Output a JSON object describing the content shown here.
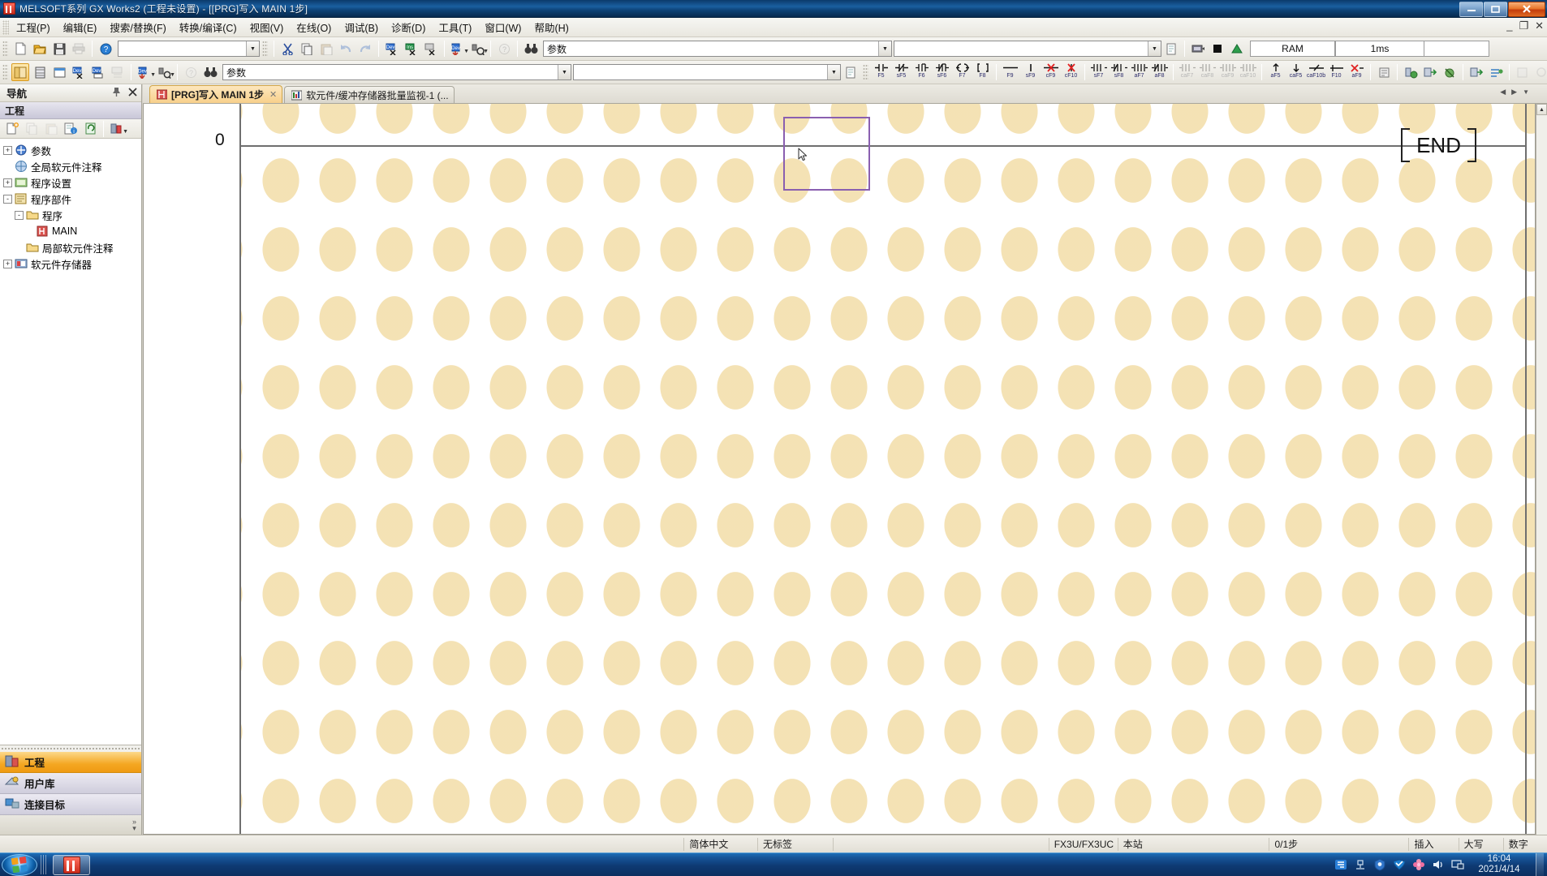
{
  "window": {
    "title": "MELSOFT系列 GX Works2 (工程未设置) - [[PRG]写入 MAIN 1步]",
    "app_icon": "gxworks2-icon",
    "minimize": "—",
    "restore": "❐",
    "close": "✕",
    "mdi_minimize": "_",
    "mdi_restore": "❐",
    "mdi_close": "✕"
  },
  "menubar": {
    "items": [
      {
        "label": "工程(P)",
        "name": "menu-project"
      },
      {
        "label": "编辑(E)",
        "name": "menu-edit"
      },
      {
        "label": "搜索/替换(F)",
        "name": "menu-find-replace"
      },
      {
        "label": "转换/编译(C)",
        "name": "menu-convert-compile"
      },
      {
        "label": "视图(V)",
        "name": "menu-view"
      },
      {
        "label": "在线(O)",
        "name": "menu-online"
      },
      {
        "label": "调试(B)",
        "name": "menu-debug"
      },
      {
        "label": "诊断(D)",
        "name": "menu-diagnostics"
      },
      {
        "label": "工具(T)",
        "name": "menu-tools"
      },
      {
        "label": "窗口(W)",
        "name": "menu-window"
      },
      {
        "label": "帮助(H)",
        "name": "menu-help"
      }
    ]
  },
  "toolbar_status": {
    "memory": "RAM",
    "scan_time": "1ms"
  },
  "toolbar2": {
    "combo_value": "参数",
    "combo_placeholder": "",
    "combo2_value": ""
  },
  "ladder_toolbar": {
    "keys": [
      "F5",
      "sF5",
      "F6",
      "sF6",
      "F7",
      "F8",
      "F9",
      "sF9",
      "cF9",
      "cF10",
      "sF7",
      "sF8",
      "aF7",
      "aF8",
      "caF7",
      "caF8",
      "caF9",
      "caF10",
      "aF5",
      "caF5",
      "caF10b",
      "F10",
      "aF9"
    ]
  },
  "navigation": {
    "title": "导航",
    "pin_icon": "pin-icon",
    "close_icon": "close-icon",
    "section": "工程",
    "tree": [
      {
        "label": "参数",
        "indent": 0,
        "expander": "+",
        "icon": "parameter-icon"
      },
      {
        "label": "全局软元件注释",
        "indent": 0,
        "expander": "",
        "icon": "global-comment-icon"
      },
      {
        "label": "程序设置",
        "indent": 0,
        "expander": "+",
        "icon": "program-setting-icon"
      },
      {
        "label": "程序部件",
        "indent": 0,
        "expander": "-",
        "icon": "pou-icon"
      },
      {
        "label": "程序",
        "indent": 1,
        "expander": "-",
        "icon": "folder-icon"
      },
      {
        "label": "MAIN",
        "indent": 2,
        "expander": "",
        "icon": "ladder-program-icon"
      },
      {
        "label": "局部软元件注释",
        "indent": 1,
        "expander": "",
        "icon": "folder-icon"
      },
      {
        "label": "软元件存储器",
        "indent": 0,
        "expander": "+",
        "icon": "device-memory-icon"
      }
    ],
    "bottom_items": [
      {
        "label": "工程",
        "icon": "project-icon",
        "active": true
      },
      {
        "label": "用户库",
        "icon": "user-library-icon",
        "active": false
      },
      {
        "label": "连接目标",
        "icon": "connection-destination-icon",
        "active": false
      }
    ]
  },
  "tabs": [
    {
      "label": "[PRG]写入 MAIN 1步",
      "icon": "ladder-icon",
      "active": true,
      "closable": true
    },
    {
      "label": "软元件/缓冲存储器批量监视-1 (...",
      "icon": "monitor-icon",
      "active": false,
      "closable": false
    }
  ],
  "ladder": {
    "step_number": "0",
    "end_instruction": "END",
    "bracket_left": "[",
    "bracket_right": "]",
    "cursor_color": "#8a5fb0"
  },
  "statusbar": {
    "cells": [
      {
        "label": "简体中文",
        "name": "status-language"
      },
      {
        "label": "无标签",
        "name": "status-label"
      },
      {
        "label": "",
        "name": "status-blank"
      },
      {
        "label": "FX3U/FX3UC",
        "name": "status-plc-type"
      },
      {
        "label": "本站",
        "name": "status-station"
      },
      {
        "label": "0/1步",
        "name": "status-steps"
      },
      {
        "label": "插入",
        "name": "status-insert-mode"
      },
      {
        "label": "大写",
        "name": "status-caps"
      },
      {
        "label": "数字",
        "name": "status-num"
      }
    ]
  },
  "taskbar": {
    "start_label": "start-orb",
    "items": [
      {
        "label": "GX Works2",
        "icon": "gxworks2-icon"
      }
    ],
    "tray_icons": [
      "ime-icon",
      "network-icon",
      "shield-icon",
      "security-icon",
      "flower-icon",
      "volume-icon",
      "display-icon"
    ],
    "clock_time": "16:04",
    "clock_date": "2021/4/14"
  }
}
